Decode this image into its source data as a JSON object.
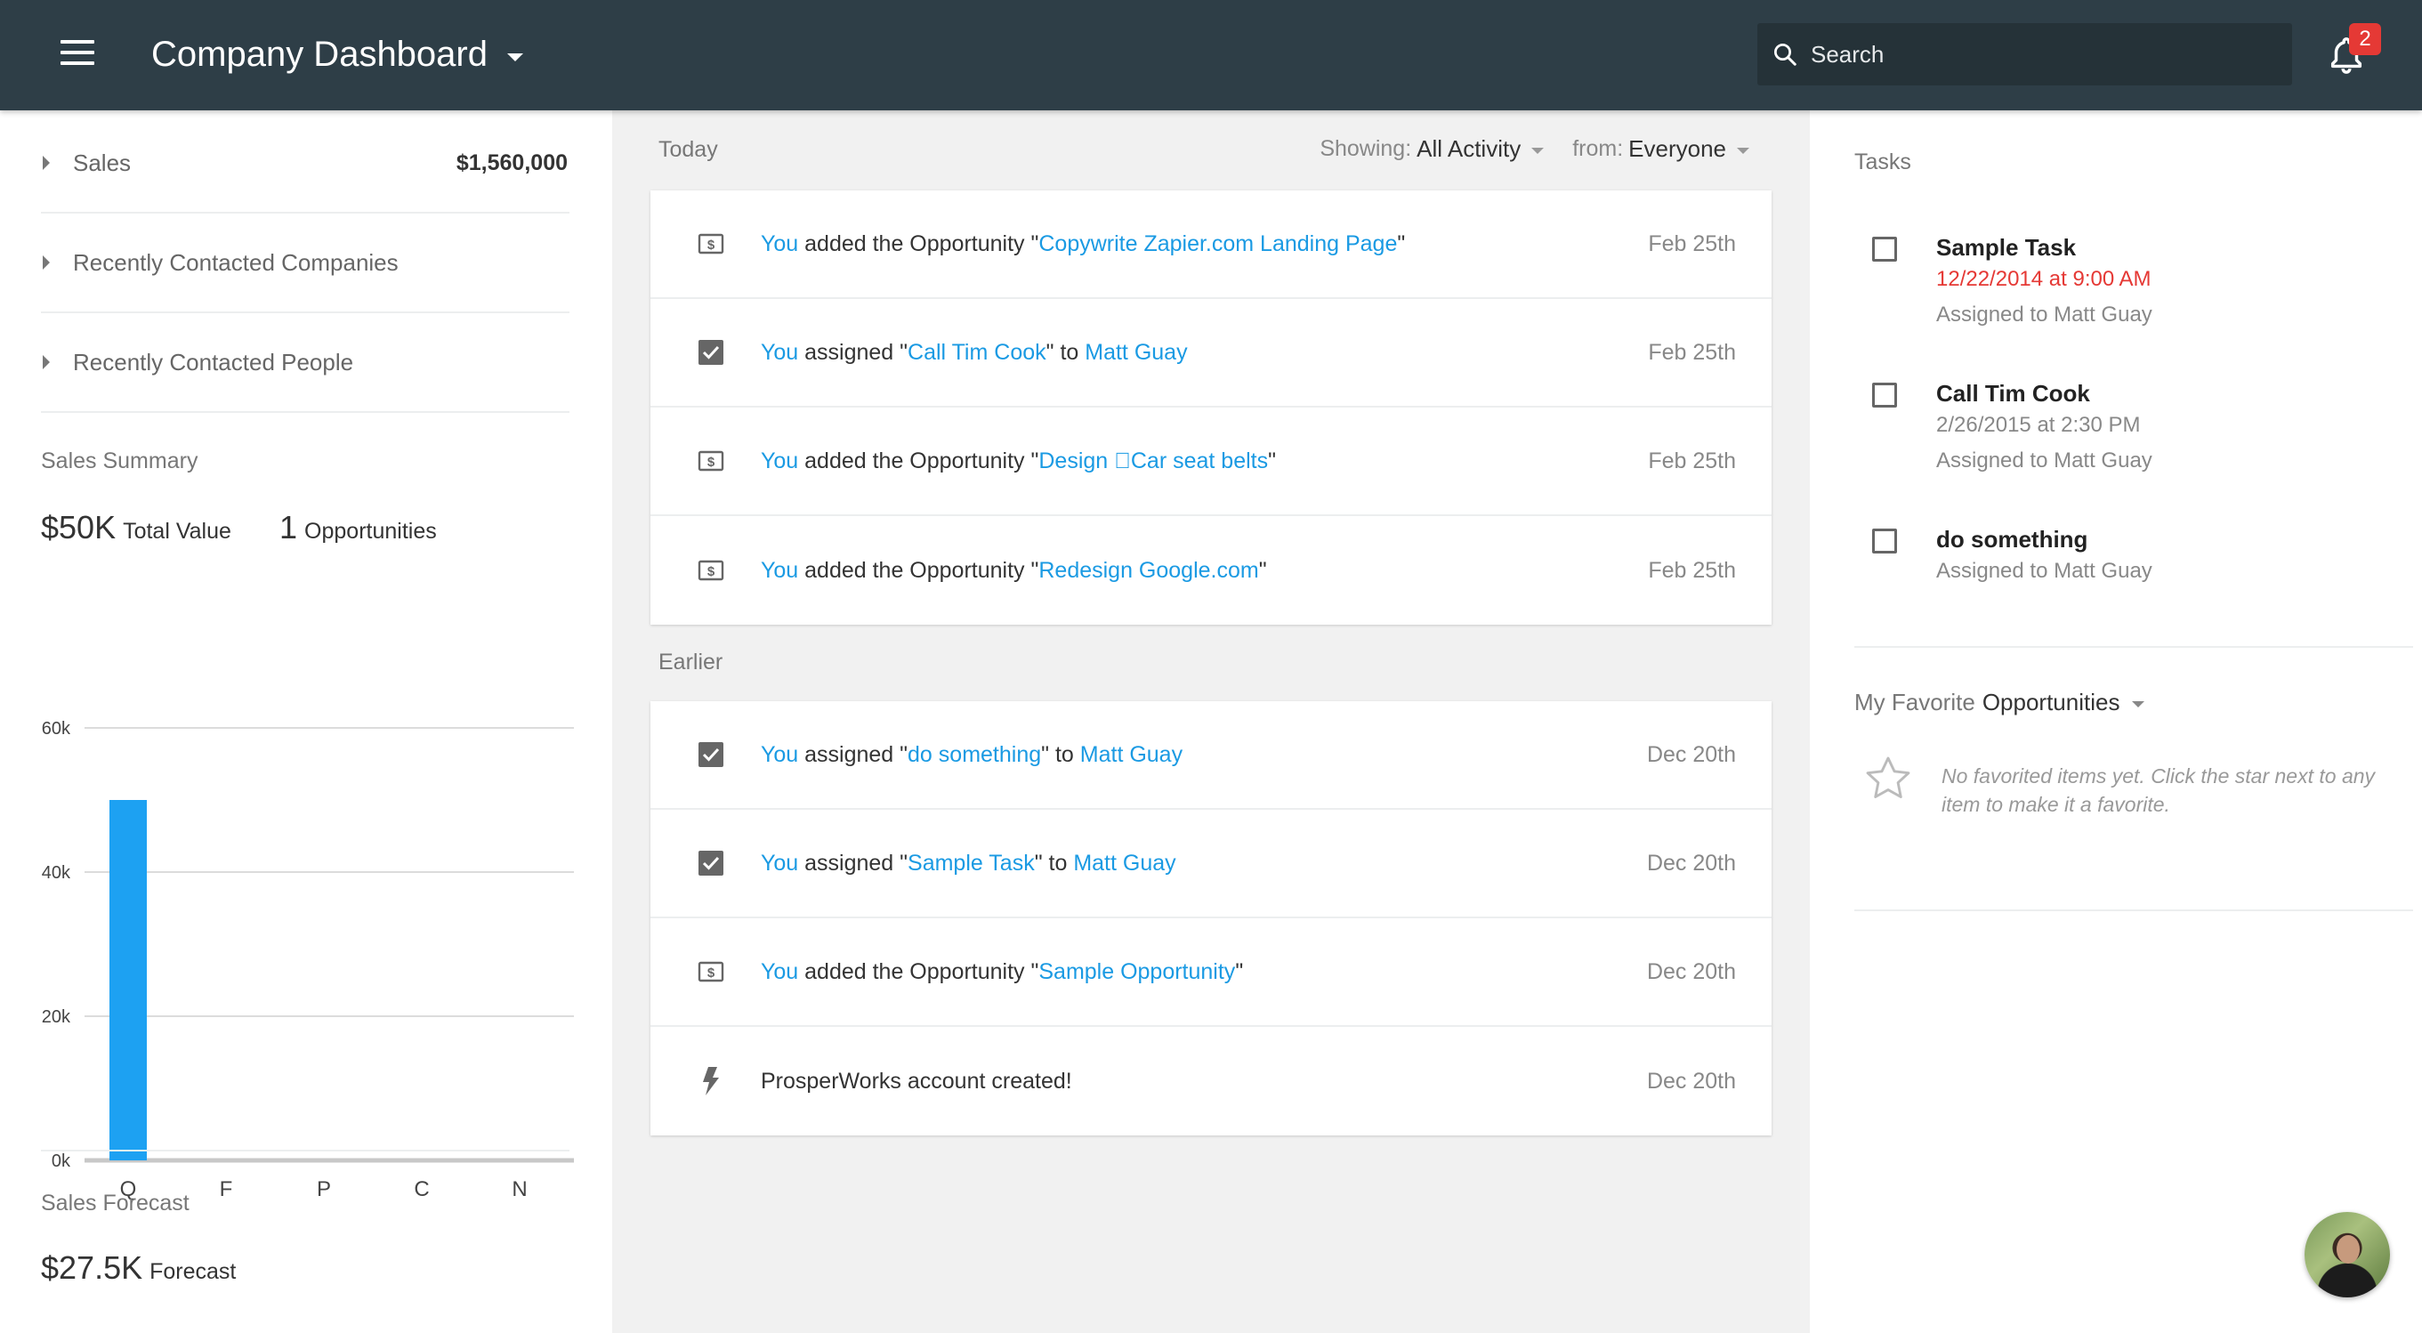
{
  "header": {
    "title": "Company Dashboard",
    "search_placeholder": "Search",
    "notification_count": "2",
    "bg_color": "#2e3e47"
  },
  "left": {
    "accordion": [
      {
        "label": "Sales",
        "value": "$1,560,000"
      },
      {
        "label": "Recently Contacted Companies",
        "value": ""
      },
      {
        "label": "Recently Contacted People",
        "value": ""
      }
    ],
    "sales_summary": {
      "label": "Sales Summary",
      "total_value": "$50K",
      "total_value_label": "Total Value",
      "opportunities": "1",
      "opportunities_label": "Opportunities"
    },
    "sales_forecast": {
      "label": "Sales Forecast",
      "value": "$27.5K",
      "value_label": "Forecast"
    }
  },
  "chart_data": {
    "type": "bar",
    "categories": [
      "Q",
      "F",
      "P",
      "C",
      "N"
    ],
    "values": [
      50000,
      0,
      0,
      0,
      0
    ],
    "y_ticks": [
      0,
      20000,
      40000,
      60000
    ],
    "y_tick_labels": [
      "0k",
      "20k",
      "40k",
      "60k"
    ],
    "ylim": [
      0,
      60000
    ],
    "grid": true,
    "bar_color": "#1da1f2",
    "title": "",
    "xlabel": "",
    "ylabel": ""
  },
  "activity": {
    "today_label": "Today",
    "earlier_label": "Earlier",
    "filters": {
      "showing_key": "Showing:",
      "showing_value": "All Activity",
      "from_key": "from:",
      "from_value": "Everyone"
    },
    "today": [
      {
        "icon": "dollar-icon",
        "parts": [
          {
            "t": "You",
            "link": true
          },
          {
            "t": " added the Opportunity \""
          },
          {
            "t": "Copywrite Zapier.com Landing Page",
            "link": true
          },
          {
            "t": "\""
          }
        ],
        "date": "Feb 25th"
      },
      {
        "icon": "checkbox-icon",
        "parts": [
          {
            "t": "You",
            "link": true
          },
          {
            "t": " assigned \""
          },
          {
            "t": "Call Tim Cook",
            "link": true
          },
          {
            "t": "\" to "
          },
          {
            "t": "Matt Guay",
            "link": true
          }
        ],
        "date": "Feb 25th"
      },
      {
        "icon": "dollar-icon",
        "parts": [
          {
            "t": "You",
            "link": true
          },
          {
            "t": " added the Opportunity \""
          },
          {
            "t": "Design Car seat belts",
            "link": true
          },
          {
            "t": "\""
          }
        ],
        "date": "Feb 25th"
      },
      {
        "icon": "dollar-icon",
        "parts": [
          {
            "t": "You",
            "link": true
          },
          {
            "t": " added the Opportunity \""
          },
          {
            "t": "Redesign Google.com",
            "link": true
          },
          {
            "t": "\""
          }
        ],
        "date": "Feb 25th"
      }
    ],
    "earlier": [
      {
        "icon": "checkbox-icon",
        "parts": [
          {
            "t": "You",
            "link": true
          },
          {
            "t": " assigned \""
          },
          {
            "t": "do something",
            "link": true
          },
          {
            "t": "\" to "
          },
          {
            "t": "Matt Guay",
            "link": true
          }
        ],
        "date": "Dec 20th"
      },
      {
        "icon": "checkbox-icon",
        "parts": [
          {
            "t": "You",
            "link": true
          },
          {
            "t": " assigned \""
          },
          {
            "t": "Sample Task",
            "link": true
          },
          {
            "t": "\" to "
          },
          {
            "t": "Matt Guay",
            "link": true
          }
        ],
        "date": "Dec 20th"
      },
      {
        "icon": "dollar-icon",
        "parts": [
          {
            "t": "You",
            "link": true
          },
          {
            "t": " added the Opportunity \""
          },
          {
            "t": "Sample Opportunity",
            "link": true
          },
          {
            "t": "\""
          }
        ],
        "date": "Dec 20th"
      },
      {
        "icon": "bolt-icon",
        "parts": [
          {
            "t": "ProsperWorks account created!"
          }
        ],
        "date": "Dec 20th"
      }
    ],
    "link_color": "#1a9ae3"
  },
  "right": {
    "tasks_label": "Tasks",
    "tasks": [
      {
        "title": "Sample Task",
        "lines": [
          {
            "t": "12/22/2014 at 9:00 AM",
            "overdue": true
          },
          {
            "t": "Assigned to Matt Guay"
          }
        ]
      },
      {
        "title": "Call Tim Cook",
        "lines": [
          {
            "t": "2/26/2015 at 2:30 PM"
          },
          {
            "t": "Assigned to Matt Guay"
          }
        ]
      },
      {
        "title": "do something",
        "lines": [
          {
            "t": "Assigned to Matt Guay"
          }
        ]
      }
    ],
    "favorites": {
      "key": "My Favorite",
      "value": "Opportunities",
      "empty_text": "No favorited items yet. Click the star next to any item to make it a favorite."
    },
    "overdue_color": "#e53935"
  }
}
